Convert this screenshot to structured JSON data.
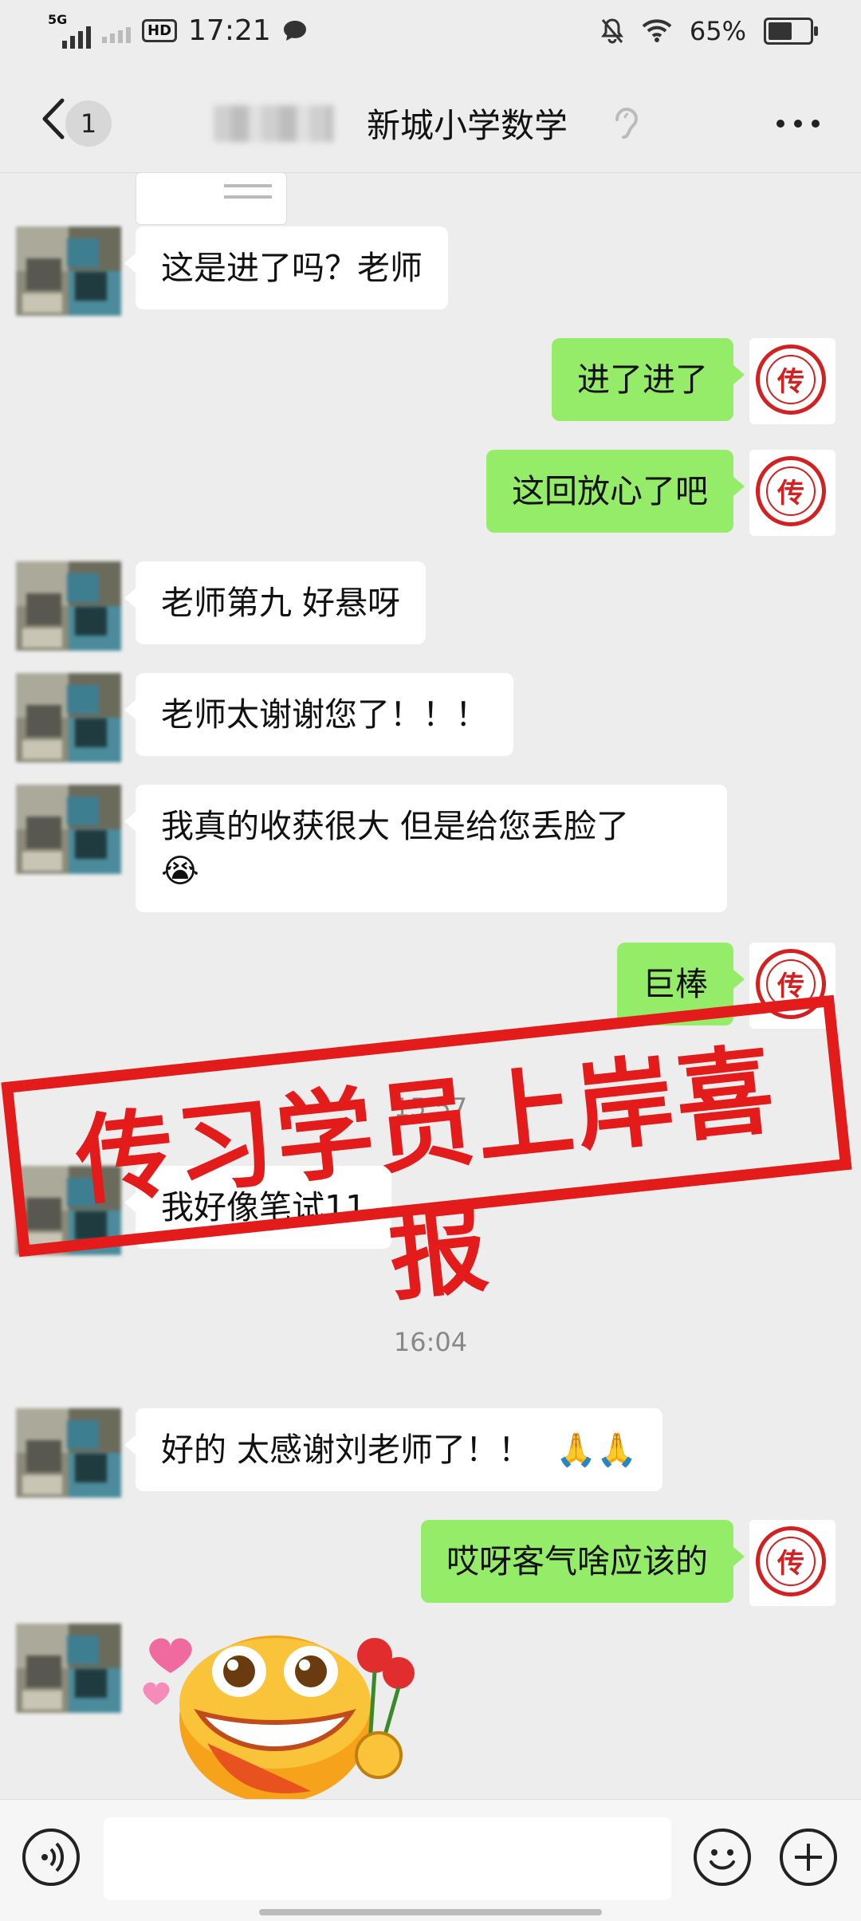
{
  "status_bar": {
    "network": "5G",
    "time": "17:21",
    "battery": "65%",
    "battery_level": 0.65
  },
  "header": {
    "unread_count": "1",
    "title": "新城小学数学"
  },
  "messages": [
    {
      "side": "in",
      "text": "这是进了吗？老师"
    },
    {
      "side": "out",
      "text": "进了进了"
    },
    {
      "side": "out",
      "text": "这回放心了吧"
    },
    {
      "side": "in",
      "text": "老师第九 好悬呀"
    },
    {
      "side": "in",
      "text": "老师太谢谢您了！！！"
    },
    {
      "side": "in",
      "text": "我真的收获很大 但是给您丢脸了",
      "emoji": "😭"
    },
    {
      "side": "out",
      "text": "巨棒"
    },
    {
      "timestamp": "15:57"
    },
    {
      "side": "in",
      "text": "我好像笔试11"
    },
    {
      "timestamp": "16:04"
    },
    {
      "side": "in",
      "text": "好的 太感谢刘老师了！！",
      "emoji": "🙏🙏"
    },
    {
      "side": "out",
      "text": "哎呀客气啥应该的"
    },
    {
      "side": "in",
      "sticker": "smiling-face-with-roses-sticker"
    }
  ],
  "banner": {
    "text": "传习学员上岸喜报",
    "color": "#e31b1b"
  },
  "colors": {
    "outgoing_bubble": "#95ec69",
    "incoming_bubble": "#ffffff",
    "background": "#ededed"
  }
}
